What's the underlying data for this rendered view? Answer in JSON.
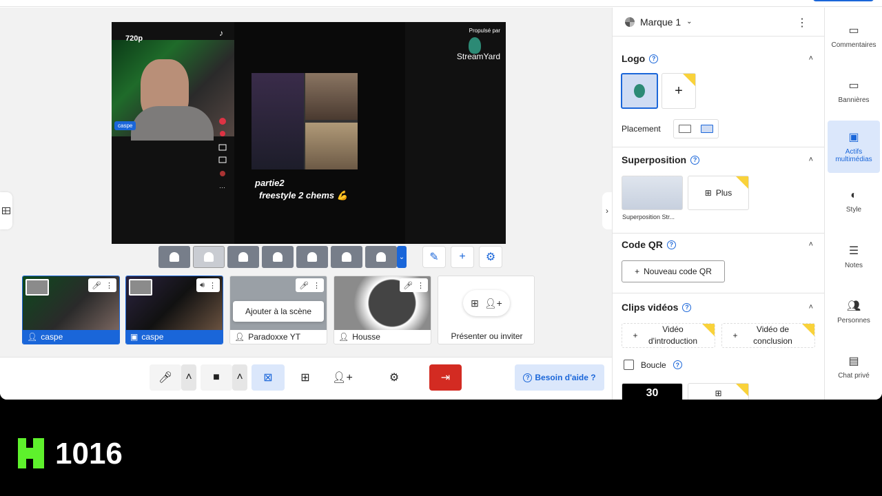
{
  "stage": {
    "resolution": "720p",
    "cam_name": "caspe",
    "brand_by": "Propulsé par",
    "brand_name": "StreamYard",
    "phone_title": "partie2",
    "phone_sub": "freestyle 2 chems 💪"
  },
  "participants": [
    {
      "name": "caspe",
      "on_stage": true,
      "kind": "cam"
    },
    {
      "name": "caspe",
      "on_stage": true,
      "kind": "screen"
    },
    {
      "name": "Paradoxxe YT",
      "on_stage": false,
      "tooltip": "Ajouter à la scène"
    },
    {
      "name": "Housse",
      "on_stage": false
    }
  ],
  "invite_label": "Présenter ou inviter",
  "help_label": "Besoin d'aide ?",
  "panel": {
    "brand": "Marque 1",
    "logo_title": "Logo",
    "placement_label": "Placement",
    "overlay_title": "Superposition",
    "overlay_thumb_label": "Superposition Str...",
    "overlay_more": "Plus",
    "qr_title": "Code QR",
    "qr_button": "Nouveau code QR",
    "clips_title": "Clips vidéos",
    "clip_intro": "Vidéo d'introduction",
    "clip_outro": "Vidéo de conclusion",
    "loop_label": "Boucle",
    "clip_thumb_text": "30"
  },
  "rail": [
    {
      "label": "Commentaires",
      "icon": "comment-icon",
      "selected": false
    },
    {
      "label": "Bannières",
      "icon": "banner-icon",
      "selected": false
    },
    {
      "label": "Actifs multimédias",
      "icon": "media-icon",
      "selected": true
    },
    {
      "label": "Style",
      "icon": "palette-icon",
      "selected": false
    },
    {
      "label": "Notes",
      "icon": "notes-icon",
      "selected": false
    },
    {
      "label": "Personnes",
      "icon": "people-icon",
      "selected": false
    },
    {
      "label": "Chat privé",
      "icon": "chat-icon",
      "selected": false
    }
  ],
  "overlay_counter": "1016",
  "colors": {
    "accent": "#1a66d9",
    "leave": "#d32b22",
    "kick": "#5ef12c"
  }
}
